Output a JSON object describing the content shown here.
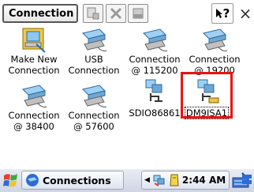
{
  "window": {
    "title": "Connection"
  },
  "toolbar": {
    "buttons": [
      "properties-icon",
      "delete-icon",
      "minimize-icon"
    ],
    "help_label": "?",
    "close_label": "×"
  },
  "items": [
    {
      "label": "Make New\nConnection",
      "icon": "make-new-connection-icon"
    },
    {
      "label": "USB\nConnection",
      "icon": "network-computer-icon"
    },
    {
      "label": "Connection\n@ 115200",
      "icon": "network-computer-icon"
    },
    {
      "label": "Connection\n@ 19200",
      "icon": "network-computer-icon"
    },
    {
      "label": "Connection\n@ 38400",
      "icon": "network-computer-icon"
    },
    {
      "label": "Connection\n@ 57600",
      "icon": "network-computer-icon"
    },
    {
      "label": "SDIO86861",
      "icon": "network-adapter-icon"
    },
    {
      "label": "DM9ISA1",
      "icon": "network-adapter-icon",
      "selected": true
    }
  ],
  "taskbar": {
    "task_label": "Connections",
    "time": "2:44 AM"
  },
  "colors": {
    "highlight": "#ee1111",
    "taskbar": "#dfe4f0"
  }
}
